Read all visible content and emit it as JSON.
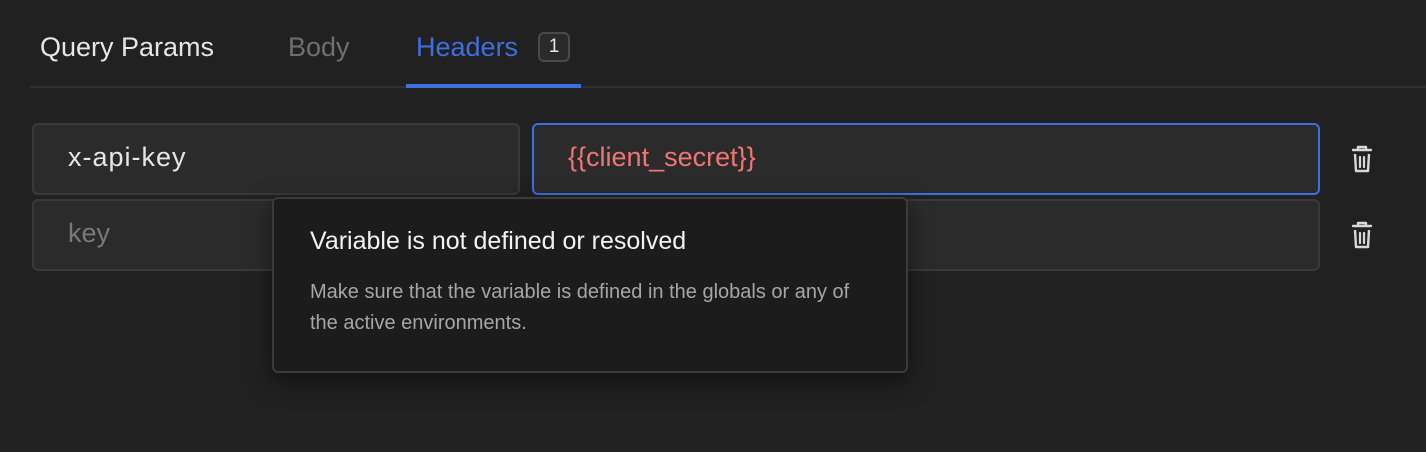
{
  "tabs": {
    "query_params": "Query Params",
    "body": "Body",
    "headers": "Headers",
    "headers_count": "1"
  },
  "header_rows": [
    {
      "key": "x-api-key",
      "value": "{{client_secret}}"
    },
    {
      "key_placeholder": "key",
      "value": ""
    }
  ],
  "tooltip": {
    "title": "Variable is not defined or resolved",
    "body": "Make sure that the variable is defined in the globals or any of the active environments."
  },
  "colors": {
    "background": "#212121",
    "accent": "#3d6fe0",
    "unresolved_variable": "#f07575"
  },
  "icons": {
    "delete": "trash-icon"
  }
}
